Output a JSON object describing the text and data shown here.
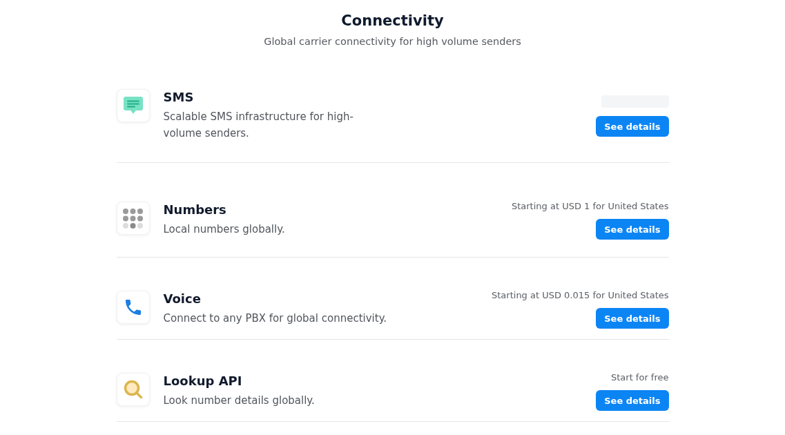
{
  "header": {
    "title": "Connectivity",
    "subtitle": "Global carrier connectivity for high volume senders"
  },
  "services": [
    {
      "name": "SMS",
      "description": "Scalable SMS infrastructure for high-volume senders.",
      "loading": true,
      "button": "See details"
    },
    {
      "name": "Numbers",
      "description": "Local numbers globally.",
      "loading": false,
      "price": "Starting at USD 1 for United States",
      "button": "See details"
    },
    {
      "name": "Voice",
      "description": "Connect to any PBX for global connectivity.",
      "loading": false,
      "price": "Starting at USD 0.015 for United States",
      "button": "See details"
    },
    {
      "name": "Lookup API",
      "description": "Look number details globally.",
      "loading": false,
      "price": "Start for free",
      "button": "See details"
    }
  ]
}
